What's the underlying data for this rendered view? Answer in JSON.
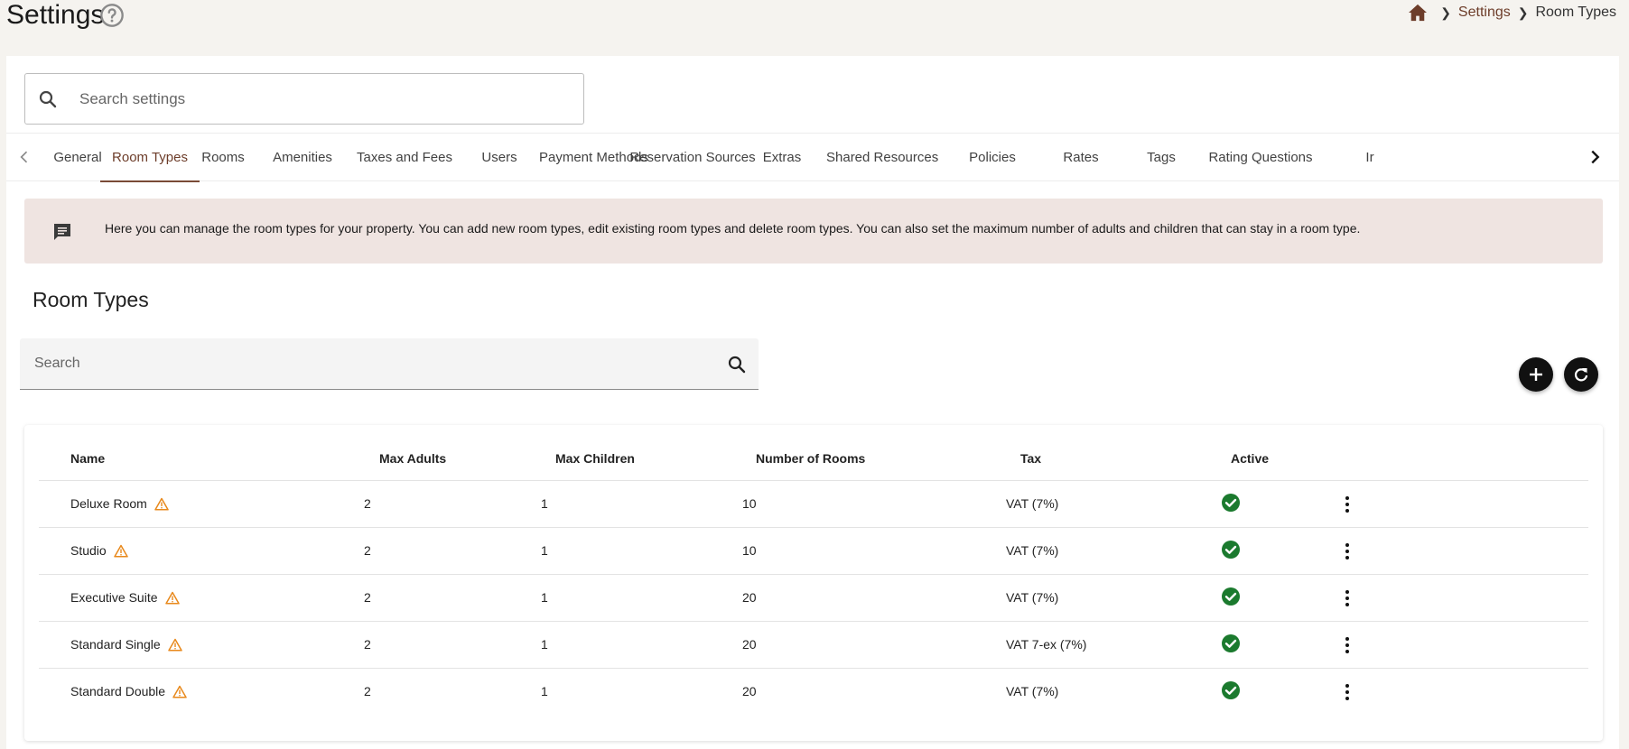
{
  "header": {
    "title": "Settings",
    "breadcrumb": {
      "link": "Settings",
      "current": "Room Types"
    }
  },
  "search_settings": {
    "placeholder": "Search settings"
  },
  "tabs": [
    {
      "label": "General"
    },
    {
      "label": "Room Types",
      "active": true
    },
    {
      "label": "Rooms"
    },
    {
      "label": "Amenities"
    },
    {
      "label": "Taxes and Fees"
    },
    {
      "label": "Users"
    },
    {
      "label": "Payment Methods"
    },
    {
      "label": "Reservation Sources"
    },
    {
      "label": "Extras"
    },
    {
      "label": "Shared Resources"
    },
    {
      "label": "Policies"
    },
    {
      "label": "Rates"
    },
    {
      "label": "Tags"
    },
    {
      "label": "Rating Questions"
    },
    {
      "label": "Ir"
    }
  ],
  "info": {
    "text": "Here you can manage the room types for your property. You can add new room types, edit existing room types and delete room types. You can also set the maximum number of adults and children that can stay in a room type."
  },
  "section": {
    "title": "Room Types"
  },
  "table_search": {
    "placeholder": "Search"
  },
  "table": {
    "headers": [
      "Name",
      "Max Adults",
      "Max Children",
      "Number of Rooms",
      "Tax",
      "Active"
    ],
    "rows": [
      {
        "name": "Deluxe Room",
        "max_adults": "2",
        "max_children": "1",
        "rooms": "10",
        "tax": "VAT (7%)"
      },
      {
        "name": "Studio",
        "max_adults": "2",
        "max_children": "1",
        "rooms": "10",
        "tax": "VAT (7%)"
      },
      {
        "name": "Executive Suite",
        "max_adults": "2",
        "max_children": "1",
        "rooms": "20",
        "tax": "VAT (7%)"
      },
      {
        "name": "Standard Single",
        "max_adults": "2",
        "max_children": "1",
        "rooms": "20",
        "tax": "VAT 7-ex (7%)"
      },
      {
        "name": "Standard Double",
        "max_adults": "2",
        "max_children": "1",
        "rooms": "20",
        "tax": "VAT (7%)"
      }
    ]
  },
  "colors": {
    "accent": "#6d3d2a",
    "info_bg": "#efe4e1",
    "warning": "#e8891c",
    "active_check": "#1b7a2e"
  },
  "icons": {
    "help": "help-circle-icon",
    "home": "home-icon",
    "search": "search-icon",
    "message": "message-icon",
    "add": "plus-icon",
    "refresh": "refresh-icon",
    "warning": "warning-icon",
    "check": "check-circle-icon",
    "more": "more-vert-icon"
  }
}
